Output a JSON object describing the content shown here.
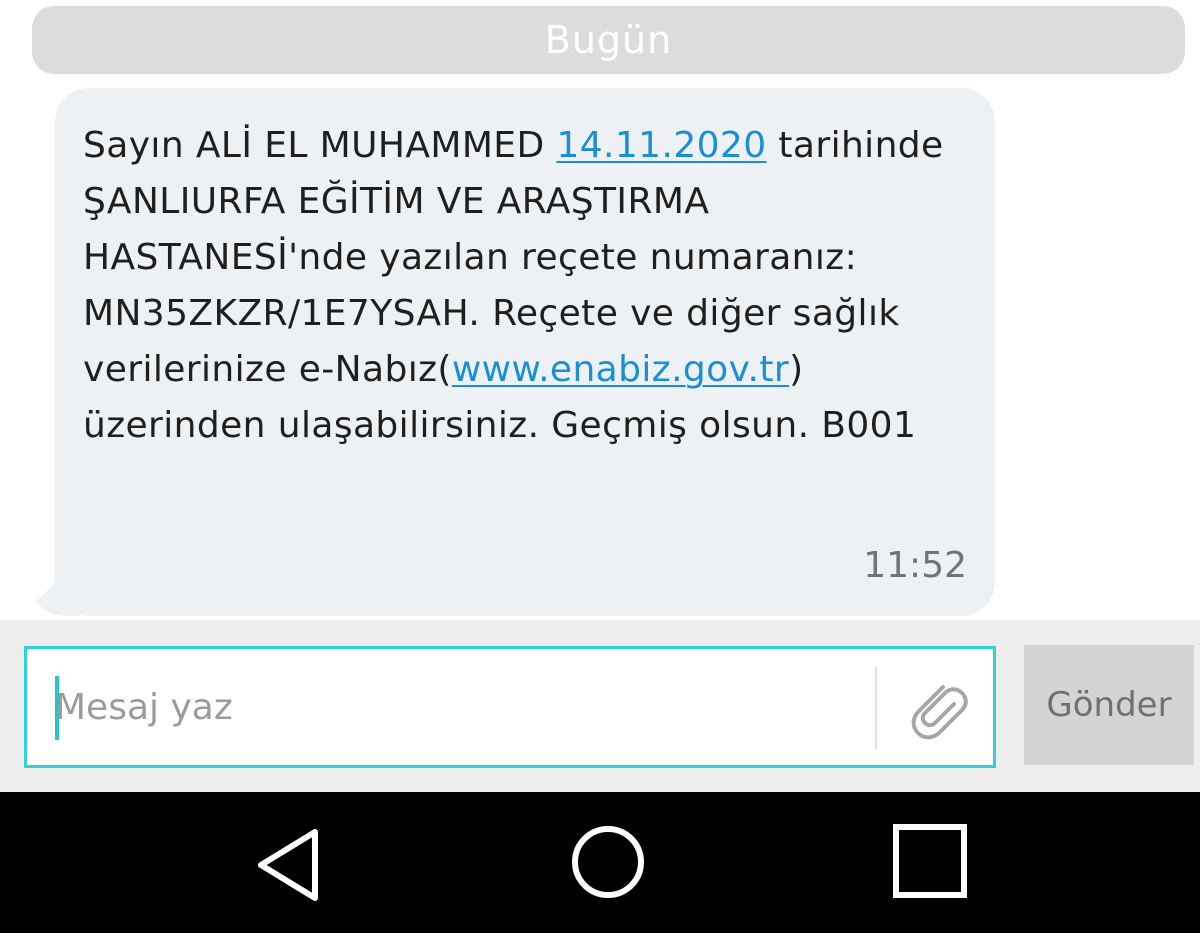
{
  "header": {
    "date_label": "Bugün"
  },
  "message": {
    "segments": [
      {
        "text": "Sayın ALİ EL MUHAMMED ",
        "link": false
      },
      {
        "text": "14.11.2020",
        "link": true
      },
      {
        "text": " tarihinde ŞANLIURFA EĞİTİM VE ARAŞTIRMA HASTANESİ'nde yazılan reçete numaranız: MN35ZKZR/1E7YSAH. Reçete ve diğer sağlık verilerinize e-Nabız(",
        "link": false
      },
      {
        "text": "www.enabiz.gov.tr",
        "link": true
      },
      {
        "text": ") üzerinden ulaşabilirsiniz. Geçmiş olsun. B001",
        "link": false
      }
    ],
    "time": "11:52"
  },
  "composer": {
    "placeholder": "Mesaj yaz",
    "attach_icon": "paperclip-icon",
    "send_label": "Gönder"
  },
  "nav": {
    "back_icon": "back-triangle-icon",
    "home_icon": "home-circle-icon",
    "recents_icon": "recents-square-icon"
  },
  "colors": {
    "link": "#1a8fd6",
    "input_border": "#2ed3d6",
    "bubble_bg": "#eef1f4",
    "date_pill_bg": "#dcdcdc"
  }
}
